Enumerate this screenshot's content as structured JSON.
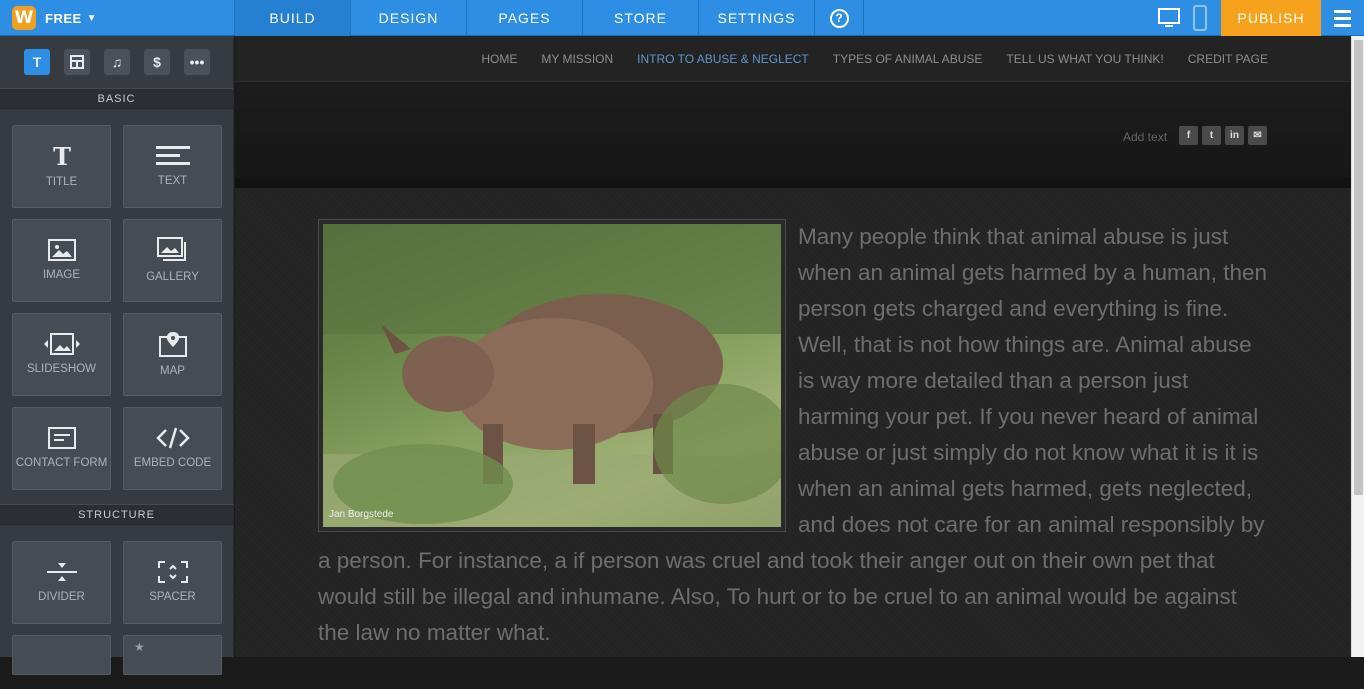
{
  "brand": {
    "plan": "FREE",
    "logo_letter": "W"
  },
  "nav": {
    "tabs": [
      "BUILD",
      "DESIGN",
      "PAGES",
      "STORE",
      "SETTINGS"
    ],
    "help": "?",
    "publish": "PUBLISH"
  },
  "sidebar": {
    "tool_icons": [
      "text-tool-icon",
      "layout-tool-icon",
      "music-tool-icon",
      "dollar-tool-icon",
      "more-tool-icon"
    ],
    "basic_heading": "BASIC",
    "basic_items": [
      {
        "label": "TITLE",
        "icon": "title-icon"
      },
      {
        "label": "TEXT",
        "icon": "text-icon"
      },
      {
        "label": "IMAGE",
        "icon": "image-icon"
      },
      {
        "label": "GALLERY",
        "icon": "gallery-icon"
      },
      {
        "label": "SLIDESHOW",
        "icon": "slideshow-icon"
      },
      {
        "label": "MAP",
        "icon": "map-icon"
      },
      {
        "label": "CONTACT FORM",
        "icon": "form-icon"
      },
      {
        "label": "EMBED CODE",
        "icon": "code-icon"
      }
    ],
    "structure_heading": "STRUCTURE",
    "structure_items": [
      {
        "label": "DIVIDER",
        "icon": "divider-icon"
      },
      {
        "label": "SPACER",
        "icon": "spacer-icon"
      }
    ]
  },
  "site": {
    "menu": [
      "HOME",
      "MY MISSION",
      "INTRO TO ABUSE & NEGLECT",
      "TYPES OF ANIMAL ABUSE",
      "TELL US WHAT YOU THINK!",
      "CREDIT PAGE"
    ],
    "active_menu": "INTRO TO ABUSE & NEGLECT",
    "add_text": "Add text",
    "socials": [
      "f",
      "t",
      "in",
      "✉"
    ],
    "photo_caption": "Jan Borgstede",
    "body": "  Many people think that animal abuse is just when an animal gets harmed by a human, then person gets charged and everything is fine. Well, that is not how things are. Animal abuse is way more detailed than a person just harming your pet. If you never heard of animal abuse or just simply do not know what it is it is when an animal gets harmed, gets neglected, and does not care for an animal responsibly by a person. For instance, a if person was cruel and took their anger out on their own pet that would still be illegal and inhumane. Also, To hurt or to be cruel to an animal would be against the law no matter what."
  }
}
